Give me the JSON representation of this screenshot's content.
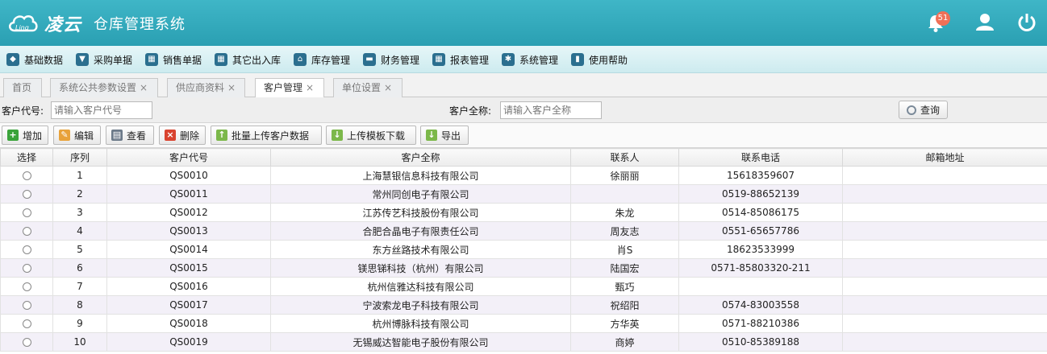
{
  "header": {
    "brand": "凌云",
    "logo_subtext": "Ling",
    "system_name": "仓库管理系统",
    "notification_count": "51"
  },
  "menu": [
    {
      "label": "基础数据",
      "icon": "cube-icon"
    },
    {
      "label": "采购单据",
      "icon": "basket-icon"
    },
    {
      "label": "销售单据",
      "icon": "calendar-icon"
    },
    {
      "label": "其它出入库",
      "icon": "calendar-icon"
    },
    {
      "label": "库存管理",
      "icon": "home-icon"
    },
    {
      "label": "财务管理",
      "icon": "card-icon"
    },
    {
      "label": "报表管理",
      "icon": "calendar-icon"
    },
    {
      "label": "系统管理",
      "icon": "gear-icon"
    },
    {
      "label": "使用帮助",
      "icon": "book-icon"
    }
  ],
  "tabs": [
    {
      "label": "首页",
      "closable": false
    },
    {
      "label": "系统公共参数设置",
      "closable": true
    },
    {
      "label": "供应商资料",
      "closable": true
    },
    {
      "label": "客户管理",
      "closable": true,
      "active": true
    },
    {
      "label": "单位设置",
      "closable": true
    }
  ],
  "search": {
    "code_label": "客户代号:",
    "code_placeholder": "请输入客户代号",
    "name_label": "客户全称:",
    "name_placeholder": "请输入客户全称",
    "query_label": "查询"
  },
  "toolbar": {
    "add": "增加",
    "edit": "编辑",
    "view": "查看",
    "delete": "删除",
    "bulk_upload": "批量上传客户数据",
    "template_download": "上传模板下载",
    "export": "导出"
  },
  "table": {
    "columns": [
      "选择",
      "序列",
      "客户代号",
      "客户全称",
      "联系人",
      "联系电话",
      "邮箱地址"
    ],
    "rows": [
      [
        "1",
        "QS0010",
        "上海慧银信息科技有限公司",
        "徐丽丽",
        "15618359607",
        ""
      ],
      [
        "2",
        "QS0011",
        "常州同创电子有限公司",
        "",
        "0519-88652139",
        ""
      ],
      [
        "3",
        "QS0012",
        "江苏传艺科技股份有限公司",
        "朱龙",
        "0514-85086175",
        ""
      ],
      [
        "4",
        "QS0013",
        "合肥合晶电子有限责任公司",
        "周友志",
        "0551-65657786",
        ""
      ],
      [
        "5",
        "QS0014",
        "东方丝路技术有限公司",
        "肖S",
        "18623533999",
        ""
      ],
      [
        "6",
        "QS0015",
        "镁思锑科技（杭州）有限公司",
        "陆国宏",
        "0571-85803320-211",
        ""
      ],
      [
        "7",
        "QS0016",
        "杭州信雅达科技有限公司",
        "甄巧",
        "",
        ""
      ],
      [
        "8",
        "QS0017",
        "宁波索龙电子科技有限公司",
        "祝绍阳",
        "0574-83003558",
        ""
      ],
      [
        "9",
        "QS0018",
        "杭州博脉科技有限公司",
        "方华英",
        "0571-88210386",
        ""
      ],
      [
        "10",
        "QS0019",
        "无锡威达智能电子股份有限公司",
        "商婷",
        "0510-85389188",
        ""
      ]
    ]
  }
}
